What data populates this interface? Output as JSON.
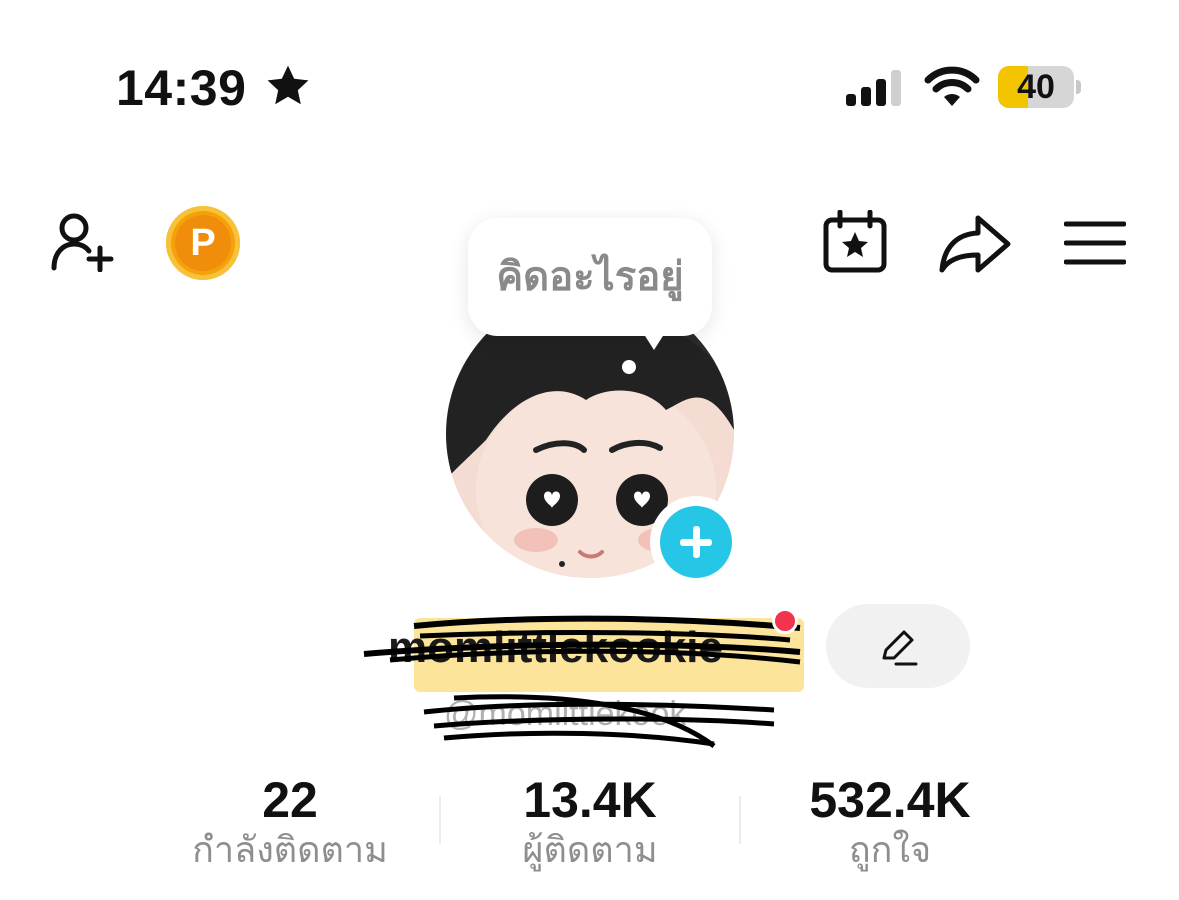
{
  "status_bar": {
    "time": "14:39",
    "battery_level": "40",
    "battery_fraction": 0.4,
    "battery_color": "#f2c500"
  },
  "top_bar": {
    "left_icons": [
      "add-friend-icon",
      "coin-icon"
    ],
    "coin_label": "P",
    "right_icons": [
      "calendar-star-icon",
      "share-arrow-icon",
      "hamburger-menu-icon"
    ]
  },
  "profile": {
    "thought_bubble": "คิดอะไรอยู่",
    "display_name": "momlittlekookie",
    "handle": "@momlittlekook",
    "add_button_color": "#26c6e6",
    "notification_dot_color": "#f2334f"
  },
  "stats": [
    {
      "value": "22",
      "label": "กำลังติดตาม"
    },
    {
      "value": "13.4K",
      "label": "ผู้ติดตาม"
    },
    {
      "value": "532.4K",
      "label": "ถูกใจ"
    }
  ]
}
